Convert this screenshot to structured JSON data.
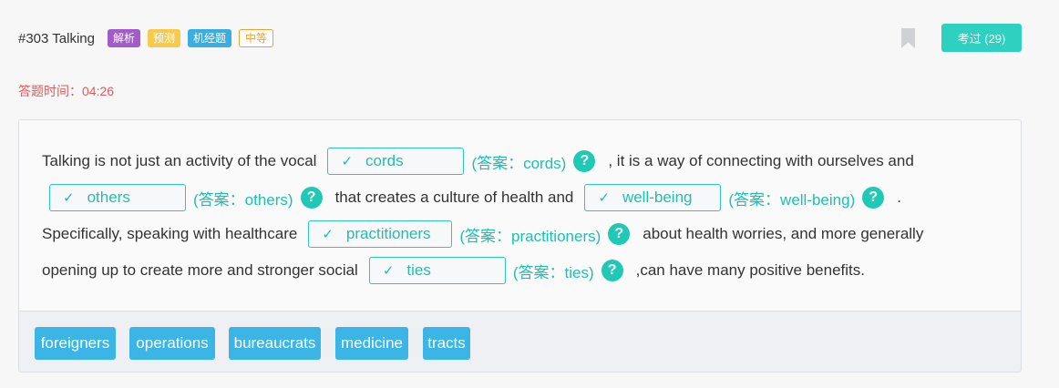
{
  "header": {
    "title": "#303 Talking",
    "tags": [
      "解析",
      "预测",
      "机经题",
      "中等"
    ],
    "pass_button": "考过 (29)"
  },
  "timer": "答题时间：04:26",
  "passage": {
    "seg1": "Talking is not just an activity of the vocal",
    "seg2": ", it is a way of connecting with ourselves and",
    "seg3": "that creates a culture of health and",
    "seg4": ".",
    "seg5": "Specifically, speaking with healthcare",
    "seg6": "about health worries, and more generally",
    "seg7": "opening up to create more and stronger social",
    "seg8": ",can have many positive benefits.",
    "check_mark": "✓",
    "help_mark": "?",
    "blanks": [
      {
        "value": "cords",
        "answer": "(答案：cords)"
      },
      {
        "value": "others",
        "answer": "(答案：others)"
      },
      {
        "value": "well-being",
        "answer": "(答案：well-being)"
      },
      {
        "value": "practitioners",
        "answer": "(答案：practitioners)"
      },
      {
        "value": "ties",
        "answer": "(答案：ties)"
      }
    ]
  },
  "word_bank": [
    "foreigners",
    "operations",
    "bureaucrats",
    "medicine",
    "tracts"
  ],
  "colors": {
    "accent": "#2ed0bf",
    "timer": "#e45a5a",
    "chip": "#3ab5e6"
  }
}
